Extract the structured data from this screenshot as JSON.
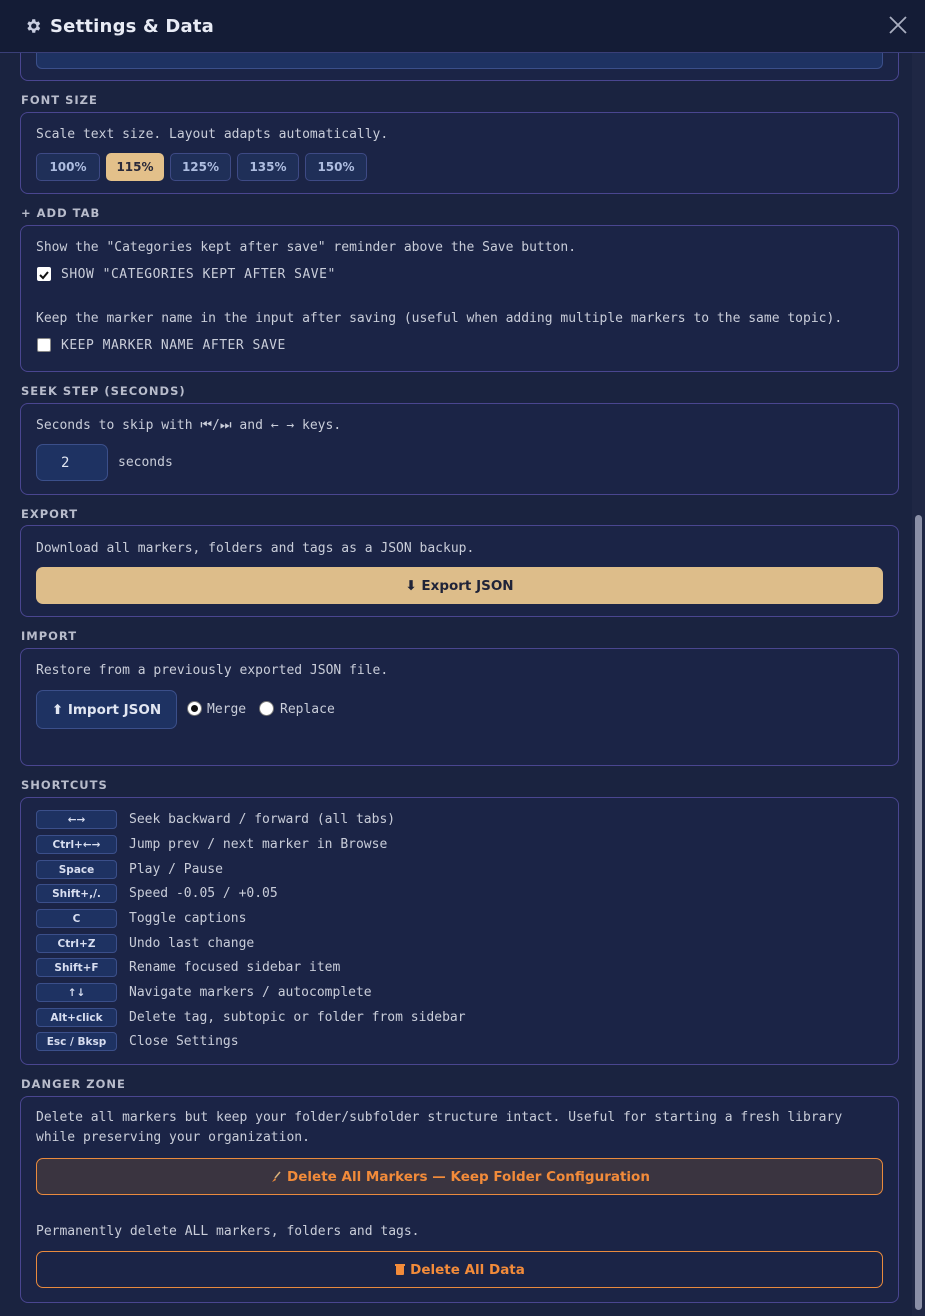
{
  "header": {
    "title": "Settings & Data"
  },
  "font_size": {
    "label": "FONT SIZE",
    "description": "Scale text size. Layout adapts automatically.",
    "options": [
      "100%",
      "115%",
      "125%",
      "135%",
      "150%"
    ],
    "selected": "115%"
  },
  "add_tab": {
    "label": "+ ADD TAB",
    "reminder_desc": "Show the \"Categories kept after save\" reminder above the Save button.",
    "reminder_checkbox": "SHOW \"CATEGORIES KEPT AFTER SAVE\"",
    "reminder_checked": true,
    "keep_name_desc": "Keep the marker name in the input after saving (useful when adding multiple markers to the same topic).",
    "keep_name_checkbox": "KEEP MARKER NAME AFTER SAVE",
    "keep_name_checked": false
  },
  "seek_step": {
    "label": "SEEK STEP (SECONDS)",
    "description": "Seconds to skip with ⏮/⏭ and ← → keys.",
    "value": "2",
    "unit": "seconds"
  },
  "export": {
    "label": "EXPORT",
    "description": "Download all markers, folders and tags as a JSON backup.",
    "button": "⬇ Export JSON"
  },
  "import": {
    "label": "IMPORT",
    "description": "Restore from a previously exported JSON file.",
    "button": "⬆ Import JSON",
    "mode_merge": "Merge",
    "mode_replace": "Replace",
    "selected_mode": "Merge"
  },
  "shortcuts": {
    "label": "SHORTCUTS",
    "items": [
      {
        "key": "←→",
        "desc": "Seek backward / forward (all tabs)"
      },
      {
        "key": "Ctrl+←→",
        "desc": "Jump prev / next marker in Browse"
      },
      {
        "key": "Space",
        "desc": "Play / Pause"
      },
      {
        "key": "Shift+,/.",
        "desc": "Speed -0.05 / +0.05"
      },
      {
        "key": "C",
        "desc": "Toggle captions"
      },
      {
        "key": "Ctrl+Z",
        "desc": "Undo last change"
      },
      {
        "key": "Shift+F",
        "desc": "Rename focused sidebar item"
      },
      {
        "key": "↑↓",
        "desc": "Navigate markers / autocomplete"
      },
      {
        "key": "Alt+click",
        "desc": "Delete tag, subtopic or folder from sidebar"
      },
      {
        "key": "Esc / Bksp",
        "desc": "Close Settings"
      }
    ]
  },
  "danger_zone": {
    "label": "DANGER ZONE",
    "keep_desc": "Delete all markers but keep your folder/subfolder structure intact. Useful for starting a fresh library while preserving your organization.",
    "keep_button": "Delete All Markers — Keep Folder Configuration",
    "all_desc": "Permanently delete ALL markers, folders and tags.",
    "all_button": "Delete All Data"
  },
  "colors": {
    "background": "#1a2340",
    "accent": "#ddbd8a",
    "danger": "#f28b3a",
    "card_border": "#4a4690"
  }
}
